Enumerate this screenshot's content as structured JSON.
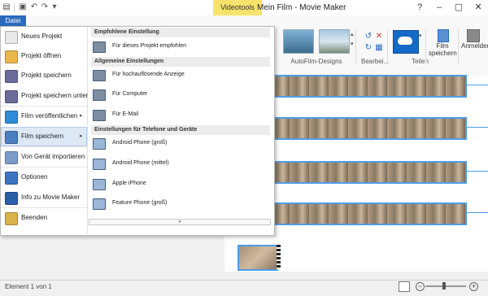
{
  "window": {
    "title": "Mein Film - Movie Maker",
    "context_tab": "Videotools",
    "controls": [
      "–",
      "▢",
      "✕"
    ],
    "help": "?"
  },
  "ribbon": {
    "file_tab": "Datei",
    "groups": {
      "autofilm": "AutoFilm-Designs",
      "edit": "Bearbei...",
      "share": "Teilen"
    },
    "film_save_label": "Film speichern",
    "signin_label": "Anmelden"
  },
  "file_menu": {
    "items": [
      {
        "label": "Neues Projekt",
        "icon": "new-project-icon",
        "color": "#e8e8e8"
      },
      {
        "label": "Projekt öffnen",
        "icon": "folder-open-icon",
        "color": "#e8b84a"
      },
      {
        "label": "Projekt speichern",
        "icon": "save-disk-icon",
        "color": "#6b6b9c"
      },
      {
        "label": "Projekt speichern unter",
        "icon": "save-as-icon",
        "color": "#6b6b9c"
      },
      {
        "label": "Film veröffentlichen",
        "icon": "globe-icon",
        "color": "#2e8bd6",
        "arrow": "▸"
      },
      {
        "label": "Film speichern",
        "icon": "film-save-icon",
        "color": "#4a7fc1",
        "arrow": "▸",
        "selected": true
      },
      {
        "label": "Von Gerät importieren",
        "icon": "device-import-icon",
        "color": "#7a9cc7"
      },
      {
        "label": "Optionen",
        "icon": "options-checklist-icon",
        "color": "#3d74c2"
      },
      {
        "label": "Info zu Movie Maker",
        "icon": "info-icon",
        "color": "#2b5fa8"
      },
      {
        "label": "Beenden",
        "icon": "exit-icon",
        "color": "#d9b24a"
      }
    ],
    "submenu": {
      "sections": [
        {
          "header": "Empfohlene Einstellung",
          "items": [
            {
              "label": "Für dieses Projekt empfohlen",
              "icon": "recommended-icon"
            }
          ]
        },
        {
          "header": "Allgemeine Einstellungen",
          "items": [
            {
              "label": "Für hochauflösende Anzeige",
              "icon": "hd-display-icon"
            },
            {
              "label": "Für Computer",
              "icon": "computer-icon"
            },
            {
              "label": "Für E-Mail",
              "icon": "email-icon"
            }
          ]
        },
        {
          "header": "Einstellungen für Telefone und Geräte",
          "items": [
            {
              "label": "Android Phone (groß)",
              "icon": "phone-icon"
            },
            {
              "label": "Android Phone (mittel)",
              "icon": "phone-icon"
            },
            {
              "label": "Apple iPhone",
              "icon": "phone-icon"
            },
            {
              "label": "Feature Phone (groß)",
              "icon": "phone-icon"
            }
          ]
        }
      ],
      "more_glyph": "▾"
    }
  },
  "status": {
    "text": "Element 1 von 1",
    "zoom_level": 0.45
  }
}
